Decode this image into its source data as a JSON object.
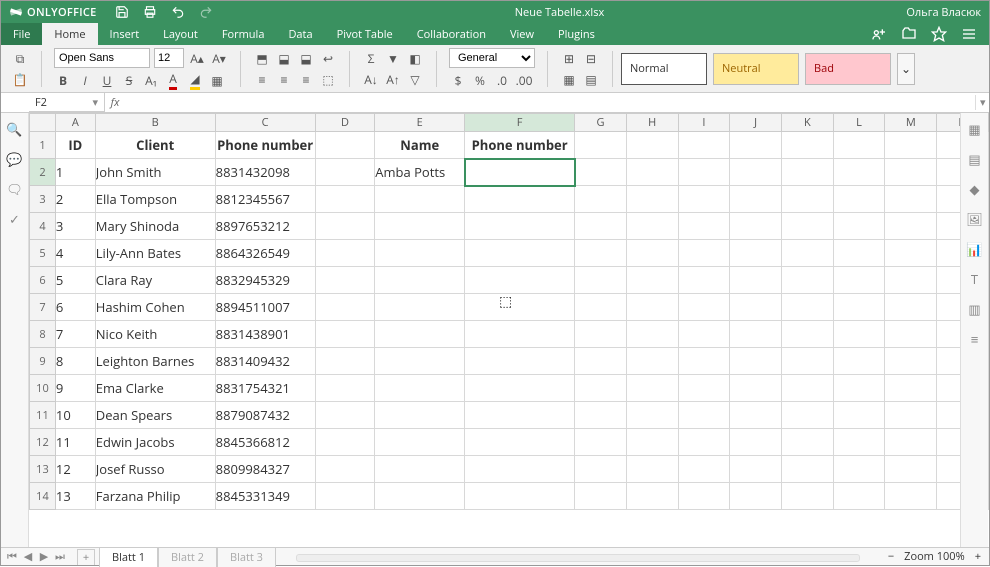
{
  "app": {
    "brand": "ONLYOFFICE",
    "document": "Neue Tabelle.xlsx",
    "user": "Ольга Власюк"
  },
  "menu": {
    "file": "File",
    "tabs": [
      "Home",
      "Insert",
      "Layout",
      "Formula",
      "Data",
      "Pivot Table",
      "Collaboration",
      "View",
      "Plugins"
    ],
    "active": "Home"
  },
  "ribbon": {
    "font_name": "Open Sans",
    "font_size": "12",
    "number_format": "General",
    "styles": {
      "normal": "Normal",
      "neutral": "Neutral",
      "bad": "Bad"
    }
  },
  "formula_bar": {
    "name_box": "F2",
    "formula": ""
  },
  "columns": [
    "A",
    "B",
    "C",
    "D",
    "E",
    "F",
    "G",
    "H",
    "I",
    "J",
    "K",
    "L",
    "M",
    "N"
  ],
  "headers": {
    "A": "ID",
    "B": "Client",
    "C": "Phone number",
    "E": "Name",
    "F": "Phone number"
  },
  "rows": [
    {
      "id": "1",
      "client": "John Smith",
      "phone": "8831432098"
    },
    {
      "id": "2",
      "client": "Ella Tompson",
      "phone": "8812345567"
    },
    {
      "id": "3",
      "client": "Mary Shinoda",
      "phone": "8897653212"
    },
    {
      "id": "4",
      "client": "Lily-Ann Bates",
      "phone": "8864326549"
    },
    {
      "id": "5",
      "client": "Clara Ray",
      "phone": "8832945329"
    },
    {
      "id": "6",
      "client": "Hashim Cohen",
      "phone": "8894511007"
    },
    {
      "id": "7",
      "client": "Nico Keith",
      "phone": "8831438901"
    },
    {
      "id": "8",
      "client": "Leighton Barnes",
      "phone": "8831409432"
    },
    {
      "id": "9",
      "client": "Ema Clarke",
      "phone": "8831754321"
    },
    {
      "id": "10",
      "client": "Dean Spears",
      "phone": "8879087432"
    },
    {
      "id": "11",
      "client": "Edwin Jacobs",
      "phone": "8845366812"
    },
    {
      "id": "12",
      "client": "Josef Russo",
      "phone": "8809984327"
    },
    {
      "id": "13",
      "client": "Farzana Philip",
      "phone": "8845331349"
    }
  ],
  "lookup": {
    "name": "Amba Potts"
  },
  "selection": {
    "cell": "F2",
    "col": "F",
    "row": "2"
  },
  "sheets": {
    "active": "Blatt 1",
    "others": [
      "Blatt 2",
      "Blatt 3"
    ]
  },
  "status": {
    "zoom": "Zoom 100%"
  }
}
